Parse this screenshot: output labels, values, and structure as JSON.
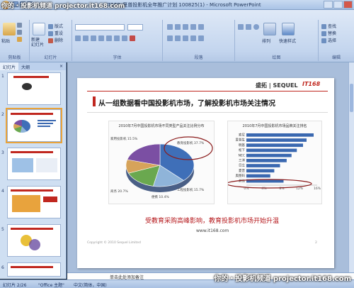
{
  "app": {
    "title": "IT168_夏普投影机全年推广计划 100825(1) - Microsoft PowerPoint"
  },
  "watermark": {
    "top": "你的・投影机频道 projector.it168.com",
    "bottom": "你的・投影机频道 projector.it168.com"
  },
  "ribbon": {
    "groups": [
      "剪贴板",
      "幻灯片",
      "字体",
      "段落",
      "绘图",
      "编辑"
    ],
    "paste_label": "粘贴",
    "new_slide_label": "新建\n幻灯片",
    "layout_label": "版式",
    "reset_label": "重设",
    "delete_label": "删除",
    "arrange_label": "排列",
    "quick_styles_label": "快速样式",
    "find_label": "查找",
    "replace_label": "替换",
    "select_label": "选择"
  },
  "leftpanel": {
    "tabs": [
      "幻灯片",
      "大纲"
    ],
    "thumbnail_numbers": [
      "1",
      "2",
      "3",
      "4",
      "5",
      "6"
    ]
  },
  "slide": {
    "headline": "从一组数据看中国投影机市场，了解投影机市场关注情况",
    "logo_text": "盛拓 | SEQUEL",
    "logo_mark": "IT168",
    "conclusion": "受教育采购高峰影响，教育投影机市场开始升温",
    "url": "www.it168.com",
    "copyright": "Copyright © 2010  Sequel Limited",
    "page_number": "2"
  },
  "chart_data": [
    {
      "type": "pie",
      "title": "2010年7月中国投影机市场不同类型产品关注比例分布",
      "categories": [
        "教育投影机",
        "家用投影机",
        "工程投影机",
        "便携投影机",
        "商务投影机"
      ],
      "values": [
        37.7,
        15.5,
        15.7,
        10.4,
        20.7
      ],
      "labels": [
        "教育投影机 37.7%",
        "家用投影机 15.5%",
        "工程投影机 15.7%",
        "便携 10.4%",
        "商务 20.7%"
      ],
      "colors": [
        "#3f6fb8",
        "#8fb4d9",
        "#6aa84f",
        "#d6a35a",
        "#7b4fa3"
      ]
    },
    {
      "type": "bar",
      "orientation": "horizontal",
      "title": "2010年7月中国投影机市场品牌关注排名",
      "categories": [
        "索尼",
        "爱普生",
        "明基",
        "松下",
        "NEC",
        "三洋",
        "日立",
        "夏普",
        "奥图码",
        "其他"
      ],
      "values": [
        15.2,
        13.6,
        12.8,
        11.4,
        10.2,
        9.1,
        7.6,
        6.3,
        5.4,
        8.4
      ],
      "xticks": [
        "0%",
        "4%",
        "8%",
        "12%",
        "16%"
      ],
      "xlim": [
        0,
        16
      ],
      "color": "#3a68b0"
    }
  ],
  "notes": {
    "placeholder": "单击此处添加备注"
  },
  "status": {
    "slide_counter": "幻灯片 2/26",
    "theme": "\"Office 主题\"",
    "language": "中文(简体，中国)"
  }
}
